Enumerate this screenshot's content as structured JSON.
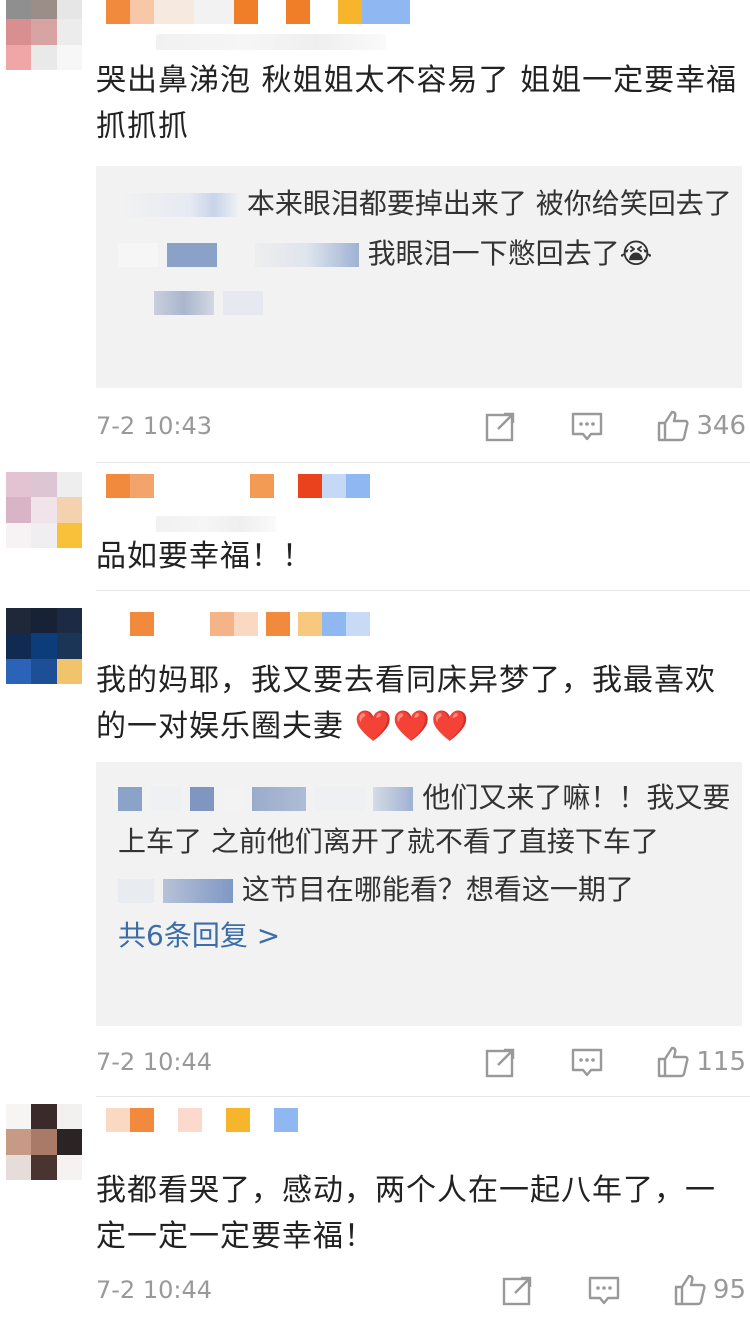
{
  "comments": [
    {
      "text": "哭出鼻涕泡 秋姐姐太不容易了 姐姐一定要幸福 抓抓抓",
      "replies": [
        {
          "text": "本来眼泪都要掉出来了 被你给笑回去了"
        },
        {
          "text": "我眼泪一下憋回去了😭"
        }
      ],
      "time": "7-2 10:43",
      "likes": "346"
    },
    {
      "text": "品如要幸福！！",
      "time": "",
      "likes": ""
    },
    {
      "text": "我的妈耶，我又要去看同床异梦了，我最喜欢的一对娱乐圈夫妻",
      "hearts": "❤️❤️❤️",
      "replies": [
        {
          "text": "他们又来了嘛！！我又要上车了 之前他们离开了就不看了直接下车了"
        },
        {
          "text": "这节目在哪能看？想看这一期了"
        }
      ],
      "more_replies": "共6条回复 >",
      "time": "7-2 10:44",
      "likes": "115"
    },
    {
      "text": "我都看哭了，感动，两个人在一起八年了，一定一定一定要幸福！",
      "time": "7-2 10:44",
      "likes": "95"
    }
  ],
  "icons": {
    "share": "share-icon",
    "comment": "comment-icon",
    "like": "thumbs-up-icon"
  },
  "colors": {
    "link": "#3b6ea8",
    "meta": "#999999",
    "reply_bg": "#f2f2f2"
  }
}
